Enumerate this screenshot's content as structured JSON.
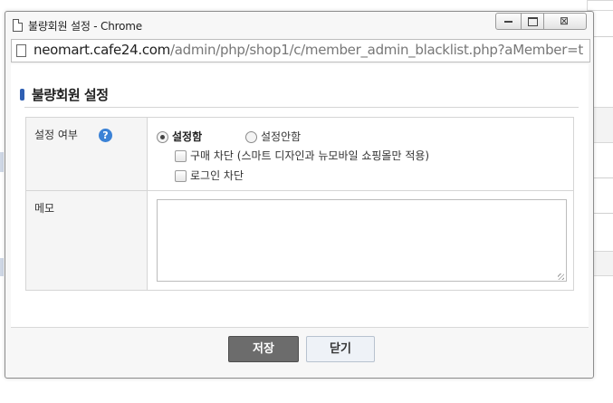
{
  "window": {
    "title": "불량회원 설정 - Chrome",
    "close_glyph": "⊠"
  },
  "address": {
    "domain": "neomart.cafe24.com",
    "path": "/admin/php/shop1/c/member_admin_blacklist.php?aMember=t"
  },
  "page": {
    "heading": "불량회원 설정"
  },
  "form": {
    "setting_label": "설정 여부",
    "help_glyph": "?",
    "option_on": "설정함",
    "option_off": "설정안함",
    "selected": "설정함",
    "block_purchase_label": "구매 차단 (스마트 디자인과 뉴모바일 쇼핑몰만 적용)",
    "block_purchase_checked": false,
    "block_login_label": "로그인 차단",
    "block_login_checked": false,
    "memo_label": "메모",
    "memo_value": ""
  },
  "buttons": {
    "save": "저장",
    "close": "닫기"
  },
  "colors": {
    "heading_mark": "#2f5fb3",
    "help_icon": "#3b82d6",
    "save_button": "#6c6c6c"
  }
}
